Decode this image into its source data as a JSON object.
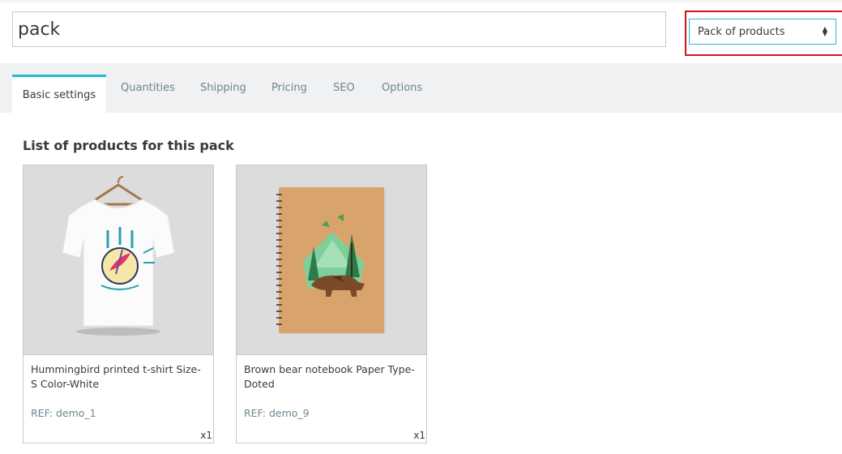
{
  "header": {
    "product_name": "pack",
    "product_type": "Pack of products"
  },
  "tabs": [
    {
      "label": "Basic settings",
      "active": true
    },
    {
      "label": "Quantities"
    },
    {
      "label": "Shipping"
    },
    {
      "label": "Pricing"
    },
    {
      "label": "SEO"
    },
    {
      "label": "Options"
    }
  ],
  "pack": {
    "title": "List of products for this pack",
    "items": [
      {
        "name": "Hummingbird printed t-shirt Size-S Color-White",
        "ref": "REF: demo_1",
        "qty": "x1",
        "image": "tshirt-image"
      },
      {
        "name": "Brown bear notebook Paper Type-Doted",
        "ref": "REF: demo_9",
        "qty": "x1",
        "image": "notebook-image"
      }
    ]
  },
  "colors": {
    "accent": "#25b9d7",
    "highlight_border": "#d0161b",
    "tab_bar_bg": "#eff1f2",
    "muted_text": "#6c868e"
  }
}
